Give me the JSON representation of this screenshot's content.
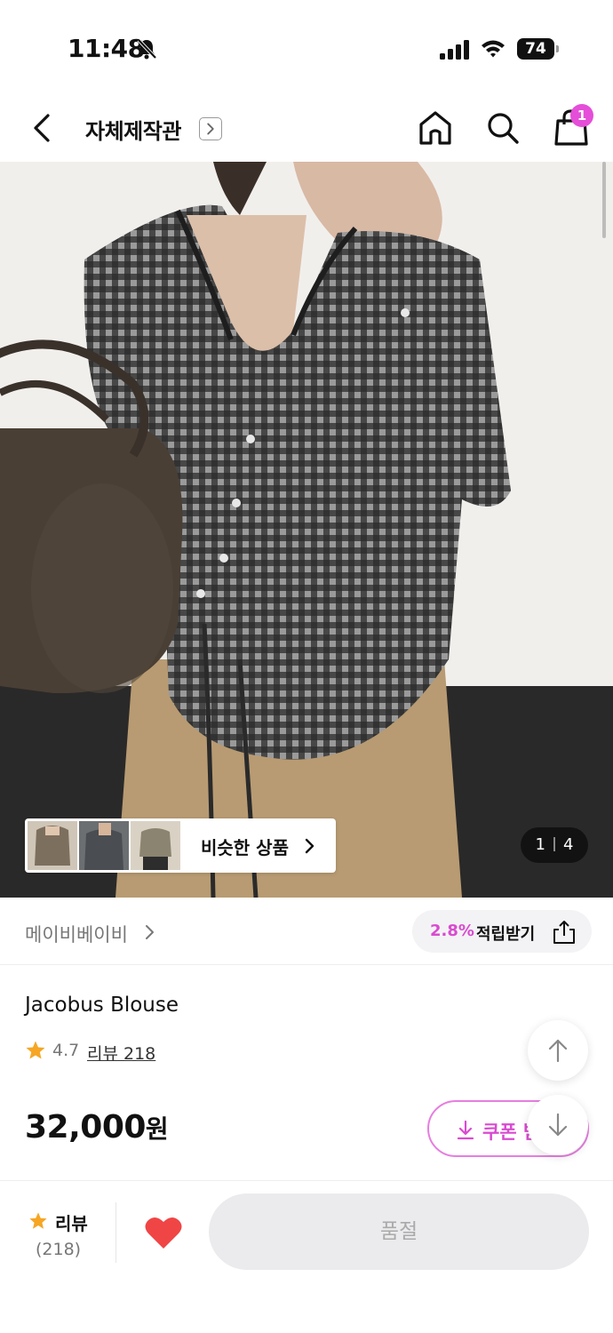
{
  "status_bar": {
    "time": "11:48",
    "battery": "74",
    "icons": [
      "bell-slash-icon",
      "cellular-signal-icon",
      "wifi-icon",
      "battery-icon"
    ]
  },
  "nav": {
    "title": "자체제작관",
    "cart_count": "1",
    "icons": [
      "back-chevron-icon",
      "chevron-right-box-icon",
      "home-icon",
      "search-icon",
      "shopping-bag-icon"
    ]
  },
  "gallery": {
    "similar_label": "비슷한 상품",
    "page_current": "1",
    "page_total": "4"
  },
  "brand": {
    "name": "메이비베이비",
    "reward_rate": "2.8%",
    "reward_label": "적립받기"
  },
  "product": {
    "name": "Jacobus Blouse",
    "rating": "4.7",
    "review_link": "리뷰 218",
    "price": "32,000",
    "price_unit": "원",
    "coupon_label": "쿠폰 받기"
  },
  "bottom_bar": {
    "review_label": "리뷰",
    "review_count": "(218)",
    "soldout_label": "품절"
  },
  "colors": {
    "accent": "#d94bd0",
    "badge": "#e54ed8",
    "heart": "#f04545",
    "star": "#f6a623"
  }
}
